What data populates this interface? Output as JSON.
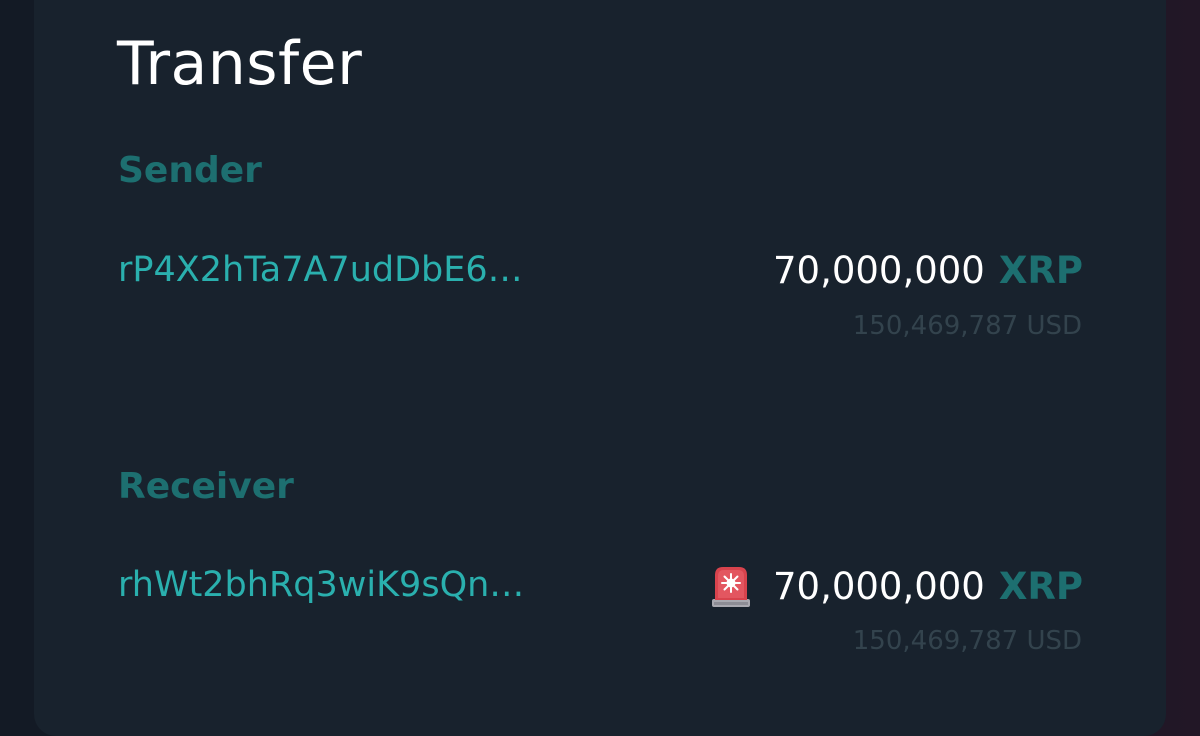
{
  "transfer": {
    "title": "Transfer",
    "sender": {
      "label": "Sender",
      "address": "rP4X2hTa7A7udDbE6…",
      "amount": "70,000,000",
      "unit": "XRP",
      "usd": "150,469,787 USD"
    },
    "receiver": {
      "label": "Receiver",
      "address": "rhWt2bhRq3wiK9sQn…",
      "alert_icon": "siren-icon",
      "amount": "70,000,000",
      "unit": "XRP",
      "usd": "150,469,787 USD"
    }
  },
  "colors": {
    "card": "#18222d",
    "label": "#1d6f70",
    "address": "#2ab0ae",
    "amount": "#ffffff",
    "usd": "#33434d"
  }
}
